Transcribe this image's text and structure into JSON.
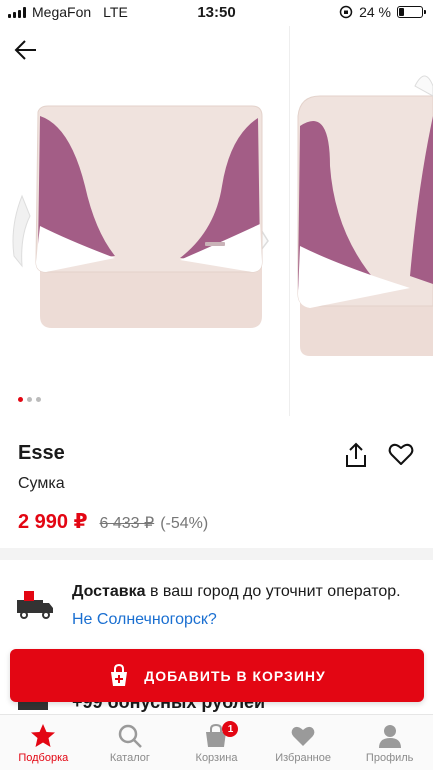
{
  "status_bar": {
    "carrier": "MegaFon",
    "network": "LTE",
    "time": "13:50",
    "battery": "24 %",
    "battery_level": 0.24
  },
  "gallery": {
    "slide_count": 3,
    "active_slide": 0,
    "accent_color": "#e30613"
  },
  "product": {
    "brand": "Esse",
    "category": "Сумка",
    "price": "2 990 ₽",
    "old_price": "6 433 ₽",
    "discount": "(-54%)"
  },
  "delivery": {
    "title": "Доставка",
    "text_part1": " в ваш город до уточнит оператор. ",
    "city_link": "Не Солнечногорск?",
    "bonus": "+99 бонусных рублей"
  },
  "cart_button": {
    "label": "ДОБАВИТЬ В КОРЗИНУ"
  },
  "tabbar": {
    "items": [
      {
        "label": "Подборка",
        "icon": "star-icon"
      },
      {
        "label": "Каталог",
        "icon": "search-icon"
      },
      {
        "label": "Корзина",
        "icon": "bag-icon",
        "badge": "1"
      },
      {
        "label": "Избранное",
        "icon": "heart-icon"
      },
      {
        "label": "Профиль",
        "icon": "user-icon"
      }
    ]
  }
}
